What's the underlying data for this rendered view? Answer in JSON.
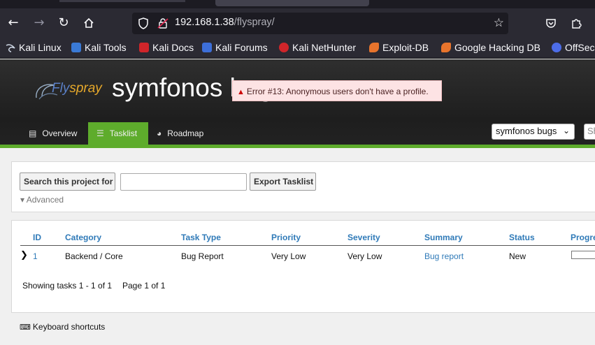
{
  "browser": {
    "url_host": "192.168.1.38",
    "url_path": "/flyspray/",
    "bookmarks": [
      {
        "label": "Kali Linux",
        "color": "#8fb3d9"
      },
      {
        "label": "Kali Tools",
        "color": "#3a7ad6"
      },
      {
        "label": "Kali Docs",
        "color": "#d0252a"
      },
      {
        "label": "Kali Forums",
        "color": "#3d6fd9"
      },
      {
        "label": "Kali NetHunter",
        "color": "#d0252a"
      },
      {
        "label": "Exploit-DB",
        "color": "#e8742c"
      },
      {
        "label": "Google Hacking DB",
        "color": "#e8742c"
      },
      {
        "label": "OffSec",
        "color": "#4d6de8"
      }
    ]
  },
  "header": {
    "logo_text": "Flyspray",
    "project_title": "symfonos bugs",
    "error_message": "Error #13: Anonymous users don't have a profile."
  },
  "menu": {
    "items": [
      {
        "label": "Overview",
        "icon": "overview-icon"
      },
      {
        "label": "Tasklist",
        "icon": "list-icon"
      },
      {
        "label": "Roadmap",
        "icon": "roadmap-icon"
      }
    ],
    "project_select": "symfonos bugs",
    "search_placeholder": "Sh"
  },
  "search": {
    "search_button": "Search this project for",
    "export_button": "Export Tasklist",
    "advanced": "▾ Advanced"
  },
  "tasks": {
    "columns": [
      "ID",
      "Category",
      "Task Type",
      "Priority",
      "Severity",
      "Summary",
      "Status",
      "Progre"
    ],
    "rows": [
      {
        "id": "1",
        "category": "Backend / Core",
        "task_type": "Bug Report",
        "priority": "Very Low",
        "severity": "Very Low",
        "summary": "Bug report",
        "status": "New",
        "progress": 0
      }
    ],
    "showing": "Showing tasks 1 - 1 of 1",
    "page": "Page 1 of 1"
  },
  "footer": {
    "shortcuts": "Keyboard shortcuts"
  },
  "colors": {
    "accent_green": "#5eac2c",
    "link_blue": "#2f7ab8",
    "error_bg": "#fde3e4"
  }
}
